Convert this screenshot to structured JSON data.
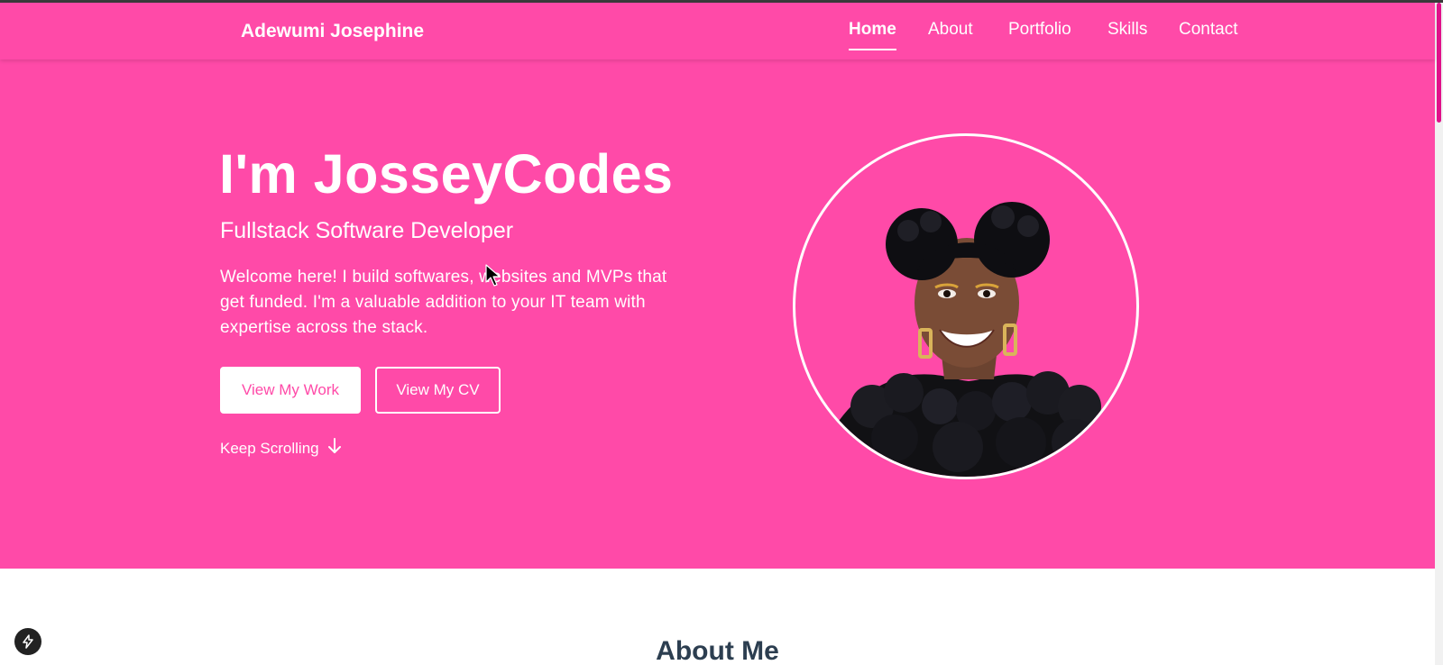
{
  "header": {
    "brand": "Adewumi Josephine",
    "nav": [
      {
        "label": "Home",
        "active": true
      },
      {
        "label": "About",
        "active": false
      },
      {
        "label": "Portfolio",
        "active": false
      },
      {
        "label": "Skills",
        "active": false
      },
      {
        "label": "Contact",
        "active": false
      }
    ]
  },
  "hero": {
    "title": "I'm JosseyCodes",
    "subtitle": "Fullstack Software Developer",
    "description": "Welcome here! I build softwares, websites and MVPs that get funded. I'm a valuable addition to your IT team with expertise across the stack.",
    "primary_button": "View My Work",
    "secondary_button": "View My CV",
    "scroll_hint": "Keep Scrolling"
  },
  "about": {
    "heading": "About Me"
  },
  "colors": {
    "accent": "#ff4aa8",
    "text_on_accent": "#ffffff",
    "heading_dark": "#2c3e50"
  },
  "icons": {
    "scroll": "arrow-down-icon",
    "fab": "lightning-icon",
    "cursor": "mouse-pointer-icon"
  }
}
